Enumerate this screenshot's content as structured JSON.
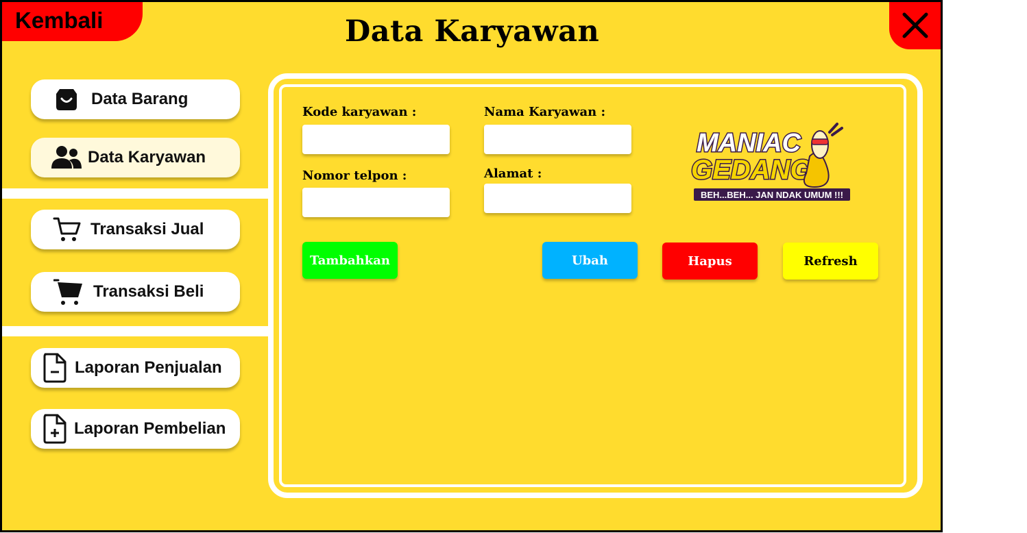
{
  "window": {
    "back_label": "Kembali",
    "title": "Data Karyawan",
    "close_icon": "close-icon"
  },
  "sidebar": {
    "items": [
      {
        "label": "Data Barang",
        "icon": "shopping-bag-icon"
      },
      {
        "label": "Data Karyawan",
        "icon": "users-icon",
        "active": true
      },
      {
        "label": "Transaksi Jual",
        "icon": "cart-outline-icon"
      },
      {
        "label": "Transaksi Beli",
        "icon": "cart-filled-icon"
      },
      {
        "label": "Laporan Penjualan",
        "icon": "file-minus-icon"
      },
      {
        "label": "Laporan Pembelian",
        "icon": "file-plus-icon"
      }
    ]
  },
  "form": {
    "kode_label": "Kode karyawan :",
    "kode_value": "",
    "nama_label": "Nama  Karyawan  :",
    "nama_value": "",
    "telpon_label": "Nomor telpon  :",
    "telpon_value": "",
    "alamat_label": "Alamat  :",
    "alamat_value": ""
  },
  "buttons": {
    "tambah": {
      "label": "Tambahkan",
      "color": "#00FF00",
      "text_color": "#ffffff"
    },
    "ubah": {
      "label": "Ubah",
      "color": "#00B2FF",
      "text_color": "#ffffff"
    },
    "hapus": {
      "label": "Hapus",
      "color": "#FF0000",
      "text_color": "#ffffff"
    },
    "refresh": {
      "label": "Refresh",
      "color": "#FFFF00",
      "text_color": "#000000"
    }
  },
  "logo": {
    "line1": "MANIAC",
    "line2": "GEDANG",
    "tagline": "BEH...BEH... JAN NDAK UMUM !!!"
  },
  "colors": {
    "background": "#FFDC2E",
    "accent_red": "#FF0000",
    "panel_border": "#FFFFFF"
  }
}
